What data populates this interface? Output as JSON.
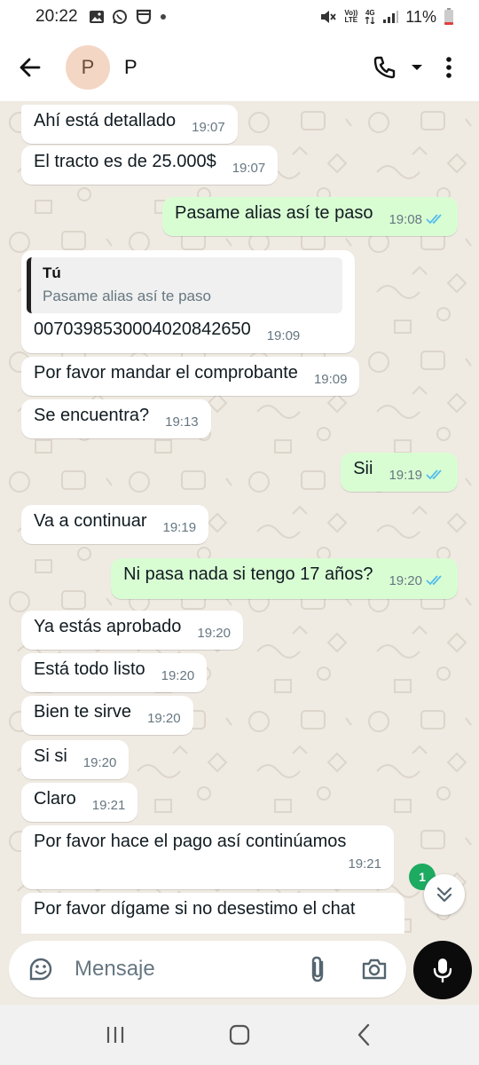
{
  "status_bar": {
    "time": "20:22",
    "notification_icons": [
      "gallery-icon",
      "whatsapp-icon",
      "notification-app-icon",
      "dot-icon"
    ],
    "network_volte": "Vo))",
    "network_lte": "LTE",
    "network_4g": "4G",
    "battery": "11%"
  },
  "header": {
    "avatar_initial": "P",
    "contact_name": "P"
  },
  "messages": [
    {
      "dir": "in",
      "text": "Ahí está detallado",
      "time": "19:07"
    },
    {
      "dir": "in",
      "text": "El tracto es de 25.000$",
      "time": "19:07"
    },
    {
      "dir": "out",
      "text": "Pasame alias así te paso",
      "time": "19:08",
      "read": true
    },
    {
      "dir": "in",
      "quote_author": "Tú",
      "quote_text": "Pasame alias así te paso",
      "text": "0070398530004020842650",
      "time": "19:09"
    },
    {
      "dir": "in",
      "text": "Por favor mandar el comprobante",
      "time": "19:09"
    },
    {
      "dir": "in",
      "text": "Se encuentra?",
      "time": "19:13"
    },
    {
      "dir": "out",
      "text": "Sii",
      "time": "19:19",
      "read": true
    },
    {
      "dir": "in",
      "text": "Va a continuar",
      "time": "19:19"
    },
    {
      "dir": "out",
      "text": "Ni pasa nada si tengo 17 años?",
      "time": "19:20",
      "read": true
    },
    {
      "dir": "in",
      "text": "Ya estás aprobado",
      "time": "19:20"
    },
    {
      "dir": "in",
      "text": "Está todo listo",
      "time": "19:20"
    },
    {
      "dir": "in",
      "text": "Bien te sirve",
      "time": "19:20"
    },
    {
      "dir": "in",
      "text": "Si si",
      "time": "19:20"
    },
    {
      "dir": "in",
      "text": "Claro",
      "time": "19:21"
    },
    {
      "dir": "in",
      "text": "Por favor hace el pago así continúamos",
      "time": "19:21"
    },
    {
      "dir": "in",
      "text": "Por favor dígame si no desestimo el chat",
      "time": ""
    }
  ],
  "unread_count": "1",
  "input": {
    "placeholder": "Mensaje"
  },
  "colors": {
    "incoming_bubble": "#ffffff",
    "outgoing_bubble": "#d9fdd3",
    "chat_background": "#efeae2",
    "read_ticks": "#53bdeb",
    "unread_badge": "#1daa61",
    "mic_button": "#0b0b0b"
  }
}
